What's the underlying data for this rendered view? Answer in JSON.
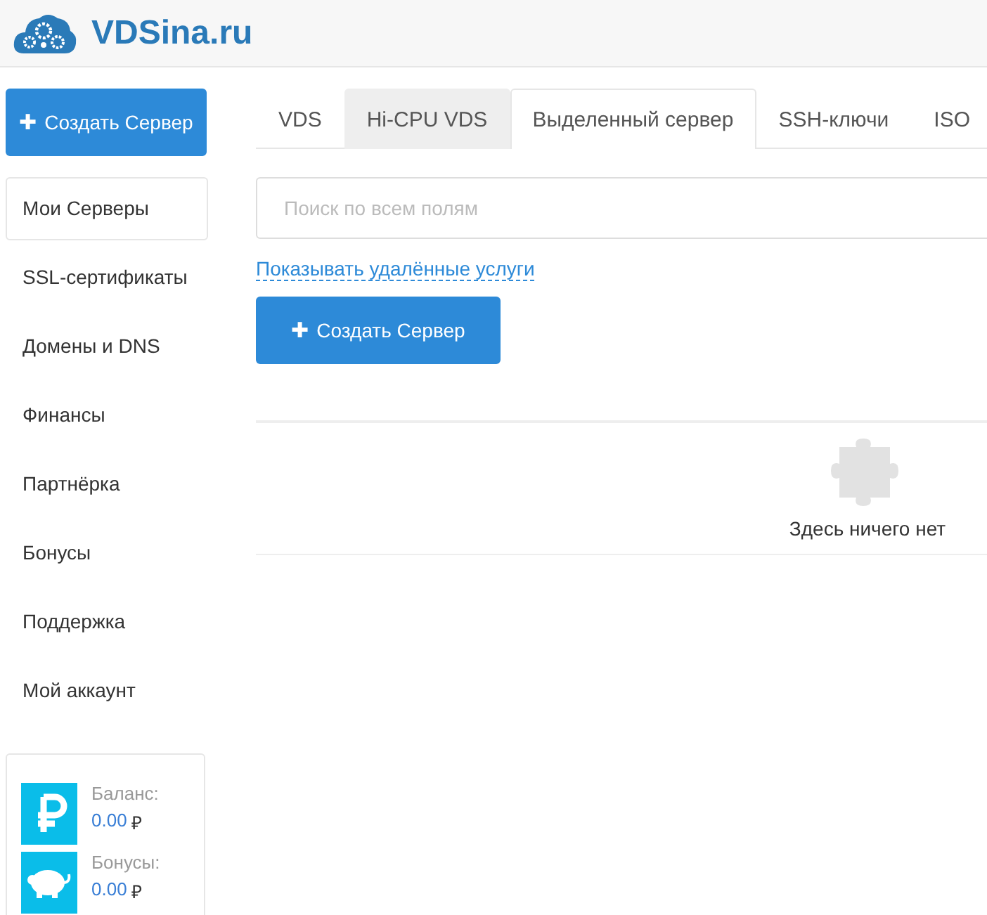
{
  "header": {
    "logo_text": "VDSina.ru"
  },
  "sidebar": {
    "create_button": {
      "icon": "✚",
      "label": "Создать Сервер"
    },
    "items": [
      {
        "label": "Мои Серверы",
        "selected": true
      },
      {
        "label": "SSL-сертификаты",
        "selected": false
      },
      {
        "label": "Домены и DNS",
        "selected": false
      },
      {
        "label": "Финансы",
        "selected": false
      },
      {
        "label": "Партнёрка",
        "selected": false
      },
      {
        "label": "Бонусы",
        "selected": false
      },
      {
        "label": "Поддержка",
        "selected": false
      },
      {
        "label": "Мой аккаунт",
        "selected": false
      }
    ],
    "wallet": [
      {
        "kind": "balance",
        "label": "Баланс:",
        "amount": "0.00",
        "currency": "₽"
      },
      {
        "kind": "bonus",
        "label": "Бонусы:",
        "amount": "0.00",
        "currency": "₽"
      }
    ]
  },
  "tabs": [
    {
      "label": "VDS",
      "selected": false,
      "highlighted": false
    },
    {
      "label": "Hi-CPU VDS",
      "selected": false,
      "highlighted": true
    },
    {
      "label": "Выделенный сервер",
      "selected": true,
      "highlighted": false
    },
    {
      "label": "SSH-ключи",
      "selected": false,
      "highlighted": false
    },
    {
      "label": "ISO",
      "selected": false,
      "highlighted": false
    }
  ],
  "search": {
    "placeholder": "Поиск по всем полям"
  },
  "show_deleted_link": "Показывать удалённые услуги",
  "create_button": {
    "icon": "✚",
    "label": "Создать Сервер"
  },
  "empty_state": {
    "message": "Здесь ничего нет"
  }
}
